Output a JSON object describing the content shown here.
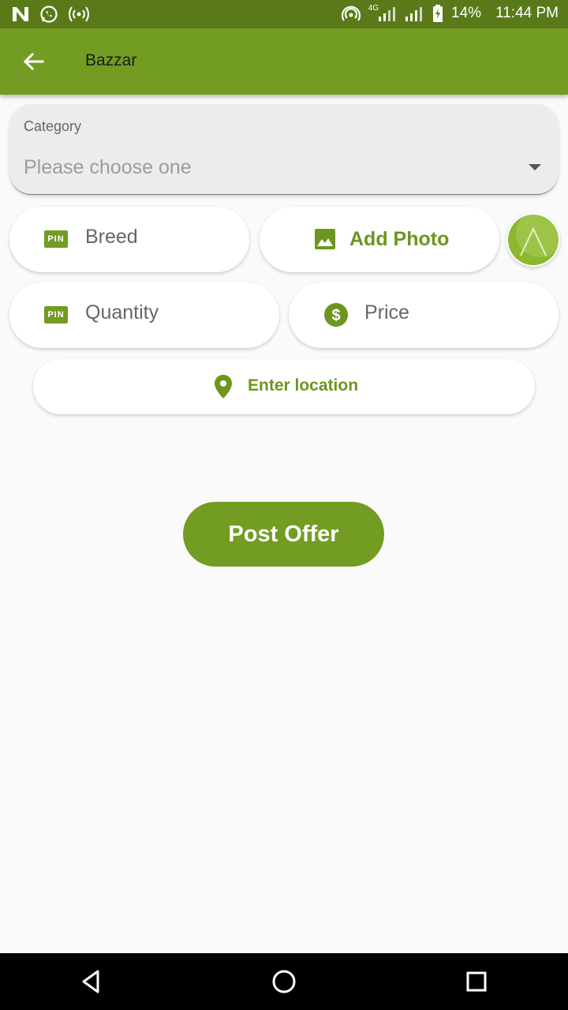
{
  "status_bar": {
    "battery": "14%",
    "time": "11:44 PM",
    "network": "4G"
  },
  "app_bar": {
    "title": "Bazzar"
  },
  "form": {
    "category": {
      "label": "Category",
      "placeholder": "Please choose one"
    },
    "breed": {
      "placeholder": "Breed",
      "icon": "pin-icon"
    },
    "add_photo": {
      "label": "Add Photo",
      "icon": "image-icon"
    },
    "quantity": {
      "placeholder": "Quantity",
      "icon": "pin-icon"
    },
    "price": {
      "placeholder": "Price",
      "icon": "dollar-icon"
    },
    "location": {
      "label": "Enter location",
      "icon": "location-pin-icon"
    },
    "submit": {
      "label": "Post Offer"
    }
  },
  "colors": {
    "primary": "#739c22",
    "status_bar": "#5a7a1a",
    "accent_text": "#6d951f",
    "background": "#fafafa"
  }
}
